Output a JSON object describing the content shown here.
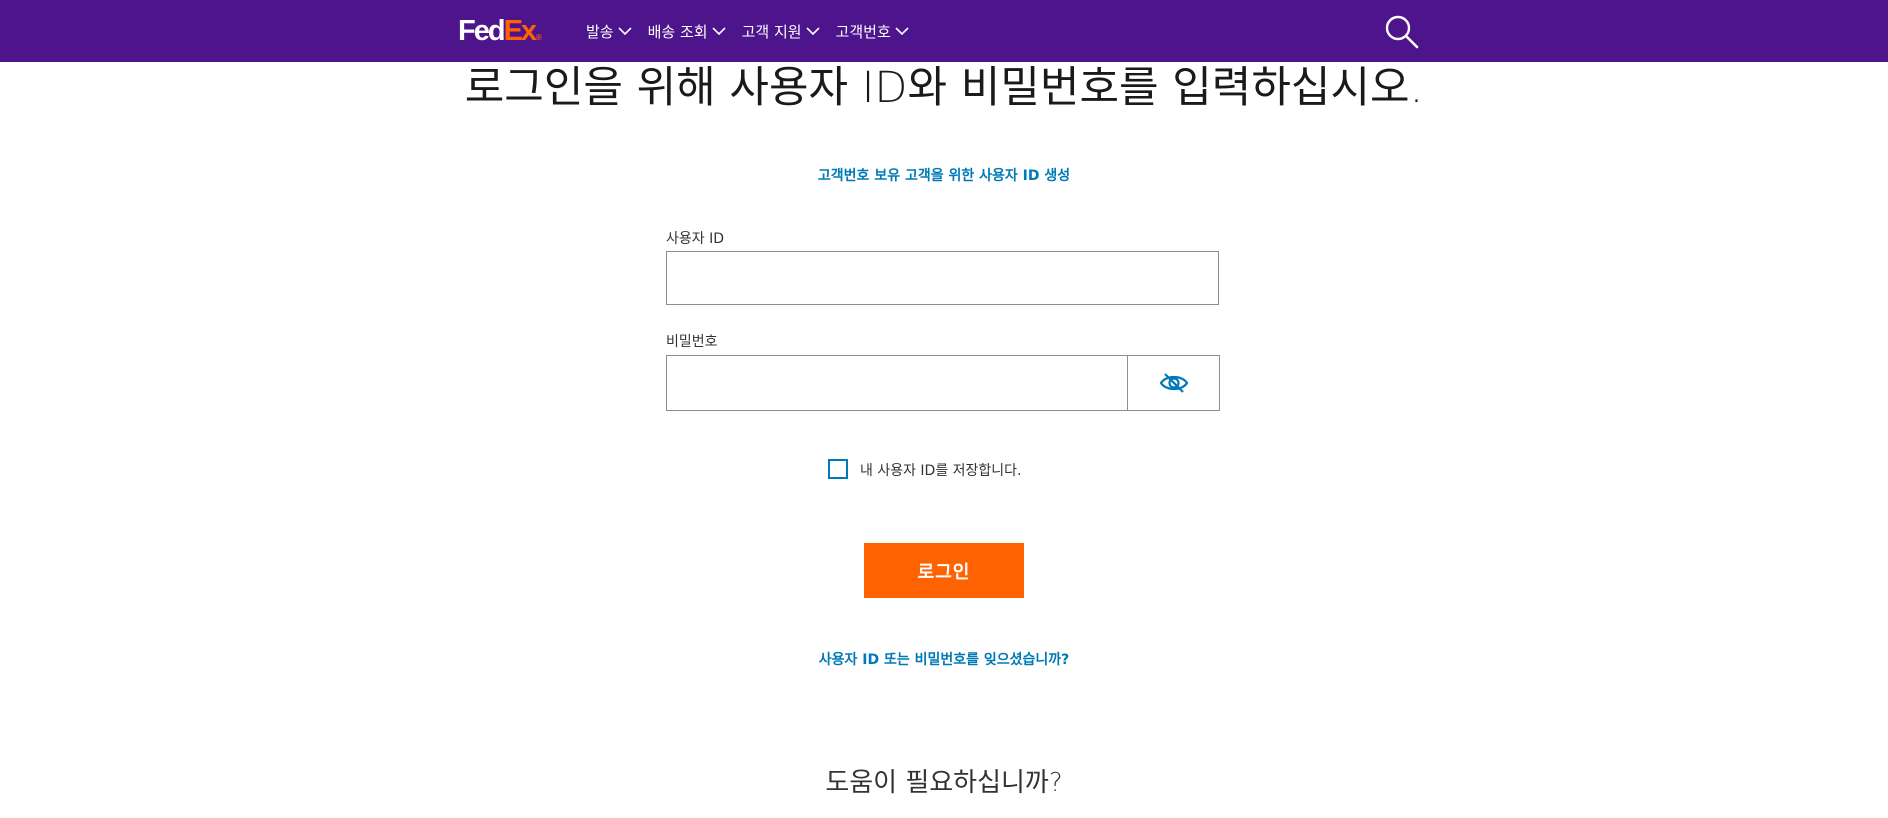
{
  "header": {
    "logo": {
      "fed": "Fed",
      "ex": "Ex",
      "mark": "®"
    },
    "nav": [
      {
        "label": "발송",
        "icon": "chevron-down-icon"
      },
      {
        "label": "배송 조회",
        "icon": "chevron-down-icon"
      },
      {
        "label": "고객 지원",
        "icon": "chevron-down-icon"
      },
      {
        "label": "고객번호",
        "icon": "chevron-down-icon"
      }
    ],
    "search_icon": "search-icon"
  },
  "main": {
    "title": "로그인을 위해 사용자 ID와 비밀번호를 입력하십시오.",
    "create_id_link": "고객번호 보유 고객을 위한 사용자 ID 생성",
    "user_id_label": "사용자 ID",
    "user_id_value": "",
    "password_label": "비밀번호",
    "password_value": "",
    "show_password_icon": "eye-slash-icon",
    "remember_label": "내 사용자 ID를 저장합니다.",
    "remember_checked": false,
    "login_button": "로그인",
    "forgot_link": "사용자 ID 또는 비밀번호를 잊으셨습니까?",
    "help_heading": "도움이 필요하십니까?"
  },
  "colors": {
    "brand_purple": "#4d148c",
    "brand_orange": "#ff6200",
    "link_blue": "#007ab7"
  }
}
